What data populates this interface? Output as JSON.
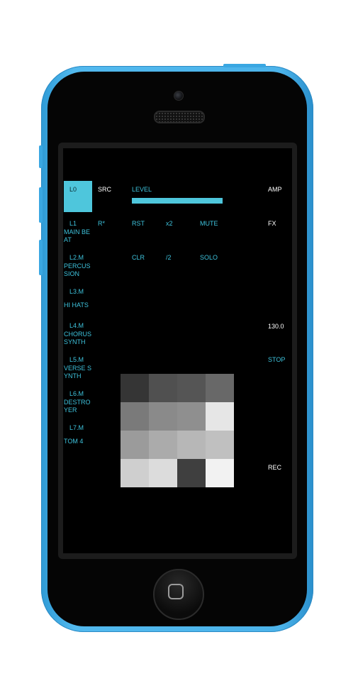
{
  "tracks": [
    {
      "id": "L0",
      "name": ""
    },
    {
      "id": "L1",
      "name": "MAIN BE\nAT"
    },
    {
      "id": "L2.M",
      "name": "PERCUS\nSION"
    },
    {
      "id": "L3.M",
      "name": "HI HATS"
    },
    {
      "id": "L4.M",
      "name": "CHORUS\nSYNTH"
    },
    {
      "id": "L5.M",
      "name": "VERSE S\nYNTH"
    },
    {
      "id": "L6.M",
      "name": "DESTRO\nYER"
    },
    {
      "id": "L7.M",
      "name": "TOM 4"
    }
  ],
  "controls": {
    "src": "SRC",
    "r": "R*",
    "level": "LEVEL",
    "level_value": 1.0,
    "rst": "RST",
    "x2": "x2",
    "mute": "MUTE",
    "clr": "CLR",
    "half": "/2",
    "solo": "SOLO"
  },
  "right": {
    "amp": "AMP",
    "fx": "FX",
    "tempo": "130.0",
    "stop": "STOP",
    "rec": "REC"
  },
  "colors": {
    "accent": "#4ec6dc",
    "text_cyan": "#3ec3dd",
    "phone_blue": "#4cb3ea",
    "screen_bg": "#000000"
  },
  "grid": [
    [
      "#353535",
      "#505050",
      "#555555",
      "#686868"
    ],
    [
      "#7a7a7a",
      "#8a8a8a",
      "#8f8f8f",
      "#e6e6e6"
    ],
    [
      "#9b9b9b",
      "#ababab",
      "#b7b7b7",
      "#c0c0c0"
    ],
    [
      "#cfcfcf",
      "#dcdcdc",
      "#3f3f3f",
      "#f2f2f2"
    ]
  ]
}
